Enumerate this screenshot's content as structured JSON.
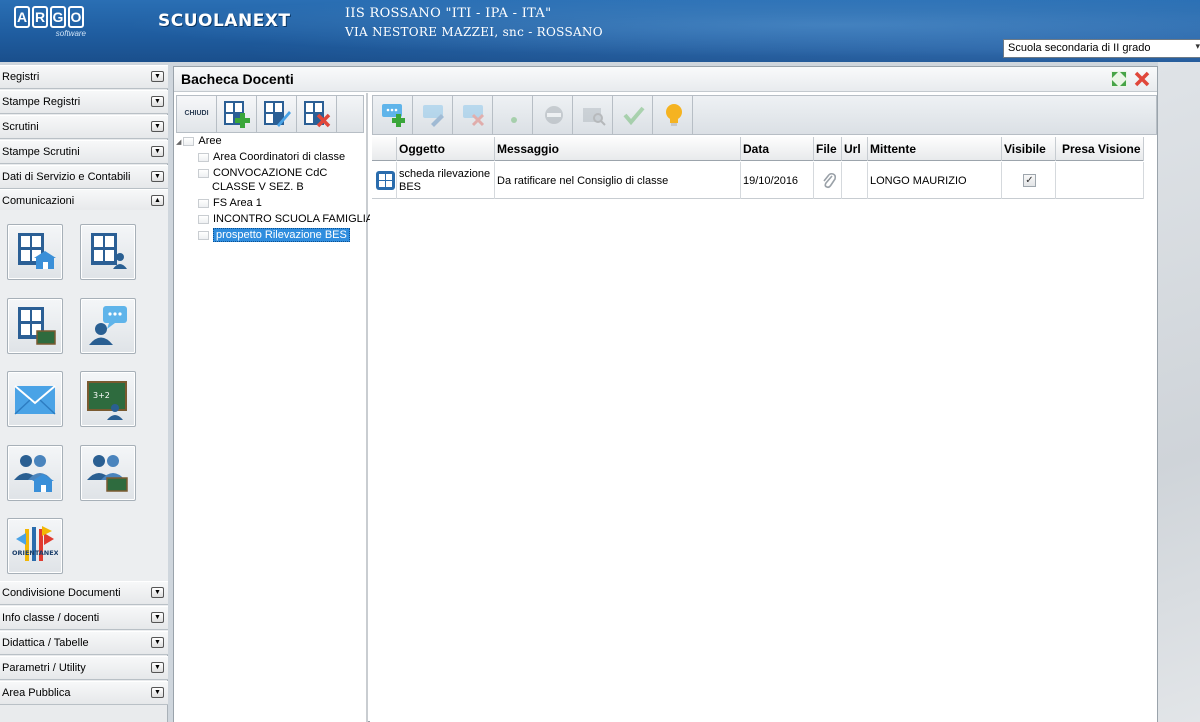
{
  "header": {
    "logo_text": "ARGO",
    "logo_sub": "software",
    "product": "SCUOLANEXT",
    "school_name": "IIS ROSSANO \"ITI - IPA - ITA\"",
    "school_address": "VIA NESTORE MAZZEI, snc - ROSSANO",
    "school_type": "Scuola secondaria di II grado"
  },
  "menu": {
    "top_items": [
      "Registri",
      "Stampe Registri",
      "Scrutini",
      "Stampe Scrutini",
      "Dati di Servizio e Contabili",
      "Comunicazioni"
    ],
    "bottom_items": [
      "Condivisione Documenti",
      "Info classe / docenti",
      "Didattica / Tabelle",
      "Parametri / Utility",
      "Area Pubblica"
    ],
    "comm_icons": [
      "bacheca-scuola-icon",
      "bacheca-docenti-icon",
      "bacheca-classe-icon",
      "messaggi-icon",
      "email-icon",
      "lavagna-icon",
      "ricevimento-genitori-icon",
      "ricevimento-classe-icon",
      "orientanext-icon"
    ],
    "orientanext_label": "ORIENTANEXT"
  },
  "panel": {
    "title": "Bacheca Docenti",
    "chiudi_label": "CHIUDI",
    "tree": {
      "root": "Aree",
      "nodes": [
        {
          "label": "Area Coordinatori di classe"
        },
        {
          "label_line1": "CONVOCAZIONE CdC",
          "label_line2": "CLASSE V SEZ. B"
        },
        {
          "label": "FS Area 1"
        },
        {
          "label": "INCONTRO SCUOLA FAMIGLIA"
        },
        {
          "label": "prospetto Rilevazione BES"
        }
      ]
    },
    "grid": {
      "columns": [
        "Oggetto",
        "Messaggio",
        "Data",
        "File",
        "Url",
        "Mittente",
        "Visibile",
        "Presa Visione"
      ],
      "rows": [
        {
          "oggetto_line1": "scheda rilevazione",
          "oggetto_line2": "BES",
          "messaggio": "Da ratificare nel Consiglio di classe",
          "data": "19/10/2016",
          "file_icon": "paperclip-icon",
          "url": "",
          "mittente": "LONGO MAURIZIO",
          "visibile": "✓",
          "presa_visione": ""
        }
      ]
    }
  },
  "colors": {
    "header_blue": "#1f5da0",
    "selection_blue": "#2f8dde",
    "close_red": "#e0473a",
    "maximize_green": "#47a447"
  }
}
